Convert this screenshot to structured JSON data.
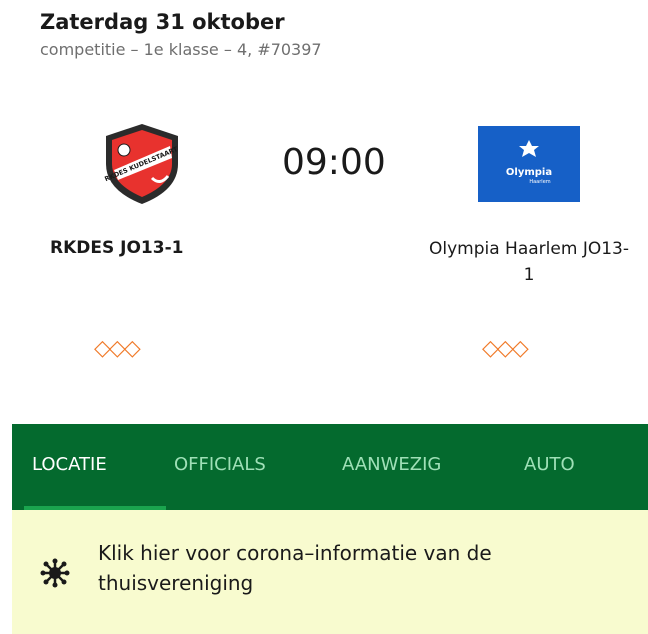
{
  "match": {
    "date": "Zaterdag 31 oktober",
    "competition": "competitie – 1e klasse – 4, #70397",
    "kickoff": "09:00",
    "home": {
      "name": "RKDES JO13-1",
      "logo_text": "RKDES KUDELSTAART"
    },
    "away": {
      "name": "Olympia Haarlem JO13-1",
      "logo_text": "Olympia",
      "logo_subtext": "Haarlem"
    }
  },
  "form_icons": {
    "home": "◇◇◇",
    "away": "◇◇◇"
  },
  "tabs": [
    {
      "label": "LOCATIE",
      "active": true
    },
    {
      "label": "OFFICIALS",
      "active": false
    },
    {
      "label": "AANWEZIG",
      "active": false
    },
    {
      "label": "AUTO",
      "active": false
    }
  ],
  "banner": {
    "text": "Klik hier voor corona–informatie van de thuisvereniging",
    "icon": "virus-icon"
  },
  "colors": {
    "tabbar": "#046a2e",
    "accent": "#1aa44e",
    "form": "#f07a29",
    "banner": "#f8fbcf",
    "away_logo": "#1660c7"
  }
}
